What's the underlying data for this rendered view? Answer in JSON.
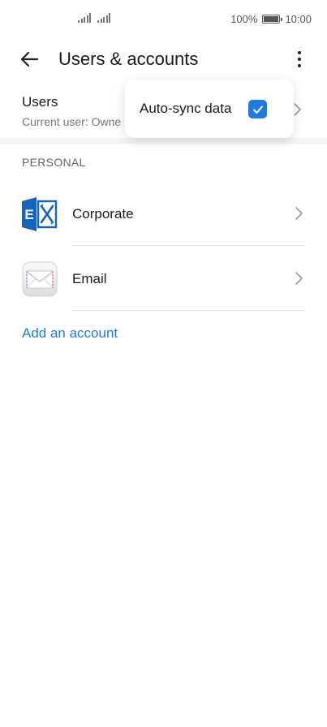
{
  "status_bar": {
    "battery": "100%",
    "time": "10:00"
  },
  "header": {
    "title": "Users & accounts",
    "back_icon": "arrow-left-icon",
    "more_icon": "more-vertical-icon"
  },
  "users": {
    "title": "Users",
    "subtitle": "Current user: Owne"
  },
  "section": {
    "personal_label": "PERSONAL"
  },
  "accounts": [
    {
      "label": "Corporate",
      "icon": "exchange-icon"
    },
    {
      "label": "Email",
      "icon": "envelope-icon"
    }
  ],
  "add_account_label": "Add an account",
  "popup": {
    "autosync_label": "Auto-sync data",
    "autosync_checked": true
  },
  "colors": {
    "accent": "#1f7ae0",
    "exchange_blue": "#1565c0"
  }
}
